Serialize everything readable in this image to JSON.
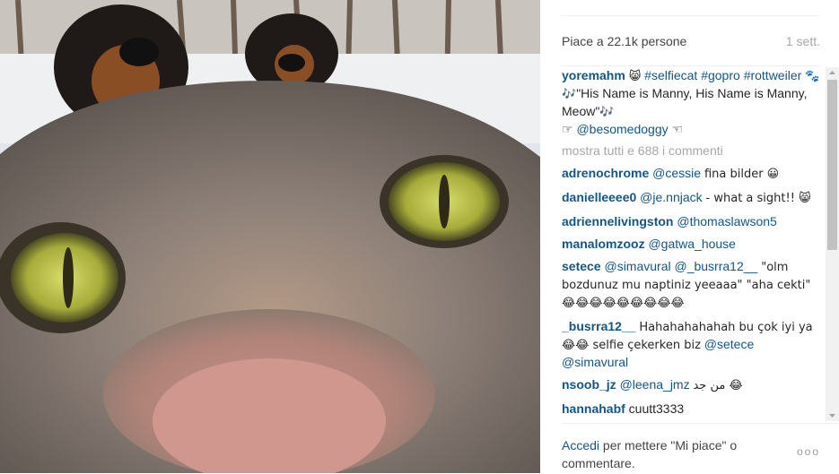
{
  "post": {
    "likes_text": "Piace a 22.1k persone",
    "time_text": "1 sett.",
    "caption": {
      "user": "yoremahm",
      "emoji_1": "😸",
      "tag_1": "#selfiecat",
      "tag_2": "#gopro",
      "tag_3": "#rottweiler",
      "emoji_2": "🐾",
      "line_2": "\"His Name is Manny, His Name is Manny, Meow\"",
      "notes": "🎶",
      "pointer_left": "☞",
      "mention": "@besomedoggy",
      "pointer_right": "☜"
    },
    "show_all_comments": "mostra tutti e 688 i commenti",
    "comments": [
      {
        "user": "adrenochrome",
        "mention": "@cessie",
        "text": "fina bilder 😀"
      },
      {
        "user": "danielleeee0",
        "mention": "@je.nnjack",
        "text": "- what a sight!! 😸"
      },
      {
        "user": "adriennelivingston",
        "mention": "@thomaslawson5",
        "text": ""
      },
      {
        "user": "manalomzooz",
        "mention": "@gatwa_house",
        "text": ""
      },
      {
        "user": "setece",
        "mention": "@simavural @_busrra12__",
        "text": "\"olm bozdunuz mu naptiniz yeeaaa\" \"aha cekti\" 😂😂😂😂😂😂😂😂😂"
      },
      {
        "user": "_busrra12__",
        "mention": "",
        "text": "Hahahahahahah bu çok iyi ya😂😂 selfie çekerken biz",
        "mention_after": "@setece @simavural"
      },
      {
        "user": "nsoob_jz",
        "mention": "@leena_jmz",
        "text": "من جد 😂"
      },
      {
        "user": "hannahabf",
        "mention": "",
        "text": "cuutt3333"
      }
    ],
    "footer": {
      "login_link": "Accedi",
      "login_rest": "per mettere \"Mi piace\" o commentare.",
      "more_options": "ooo"
    }
  },
  "colors": {
    "link": "#125688",
    "muted": "#a5a7aa",
    "text": "#262626"
  }
}
